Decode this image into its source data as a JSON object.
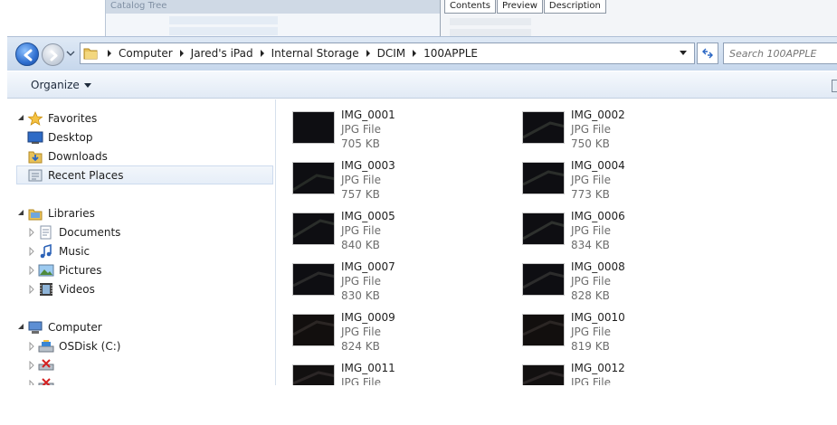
{
  "background": {
    "catalog_title": "Catalog Tree",
    "tabs": [
      "Contents",
      "Preview",
      "Description"
    ]
  },
  "address": {
    "crumbs": [
      "Computer",
      "Jared's iPad",
      "Internal Storage",
      "DCIM",
      "100APPLE"
    ],
    "icon": "folder-icon"
  },
  "search": {
    "placeholder": "Search 100APPLE"
  },
  "toolbar": {
    "organize_label": "Organize"
  },
  "nav": {
    "favorites": {
      "label": "Favorites",
      "items": [
        {
          "label": "Desktop",
          "icon": "desktop-icon"
        },
        {
          "label": "Downloads",
          "icon": "downloads-icon"
        },
        {
          "label": "Recent Places",
          "icon": "recent-places-icon",
          "selected": true
        }
      ]
    },
    "libraries": {
      "label": "Libraries",
      "items": [
        {
          "label": "Documents",
          "icon": "documents-icon"
        },
        {
          "label": "Music",
          "icon": "music-icon"
        },
        {
          "label": "Pictures",
          "icon": "pictures-icon"
        },
        {
          "label": "Videos",
          "icon": "videos-icon"
        }
      ]
    },
    "computer": {
      "label": "Computer",
      "items": [
        {
          "label": "OSDisk (C:)",
          "icon": "disk-icon"
        },
        {
          "label": "",
          "icon": "network-drive-disconnected-icon"
        },
        {
          "label": "",
          "icon": "network-drive-disconnected-icon"
        }
      ]
    }
  },
  "files": [
    {
      "name": "IMG_0001",
      "type": "JPG File",
      "size": "705 KB"
    },
    {
      "name": "IMG_0002",
      "type": "JPG File",
      "size": "750 KB"
    },
    {
      "name": "IMG_0003",
      "type": "JPG File",
      "size": "757 KB"
    },
    {
      "name": "IMG_0004",
      "type": "JPG File",
      "size": "773 KB"
    },
    {
      "name": "IMG_0005",
      "type": "JPG File",
      "size": "840 KB"
    },
    {
      "name": "IMG_0006",
      "type": "JPG File",
      "size": "834 KB"
    },
    {
      "name": "IMG_0007",
      "type": "JPG File",
      "size": "830 KB"
    },
    {
      "name": "IMG_0008",
      "type": "JPG File",
      "size": "828 KB"
    },
    {
      "name": "IMG_0009",
      "type": "JPG File",
      "size": "824 KB"
    },
    {
      "name": "IMG_0010",
      "type": "JPG File",
      "size": "819 KB"
    },
    {
      "name": "IMG_0011",
      "type": "JPG File",
      "size": ""
    },
    {
      "name": "IMG_0012",
      "type": "JPG File",
      "size": ""
    }
  ],
  "colors": {
    "navbar": "#c6d7ec",
    "back_button": "#2f6fd0",
    "selection": "#e6eef8",
    "thumbnail": "#0e0e12"
  }
}
